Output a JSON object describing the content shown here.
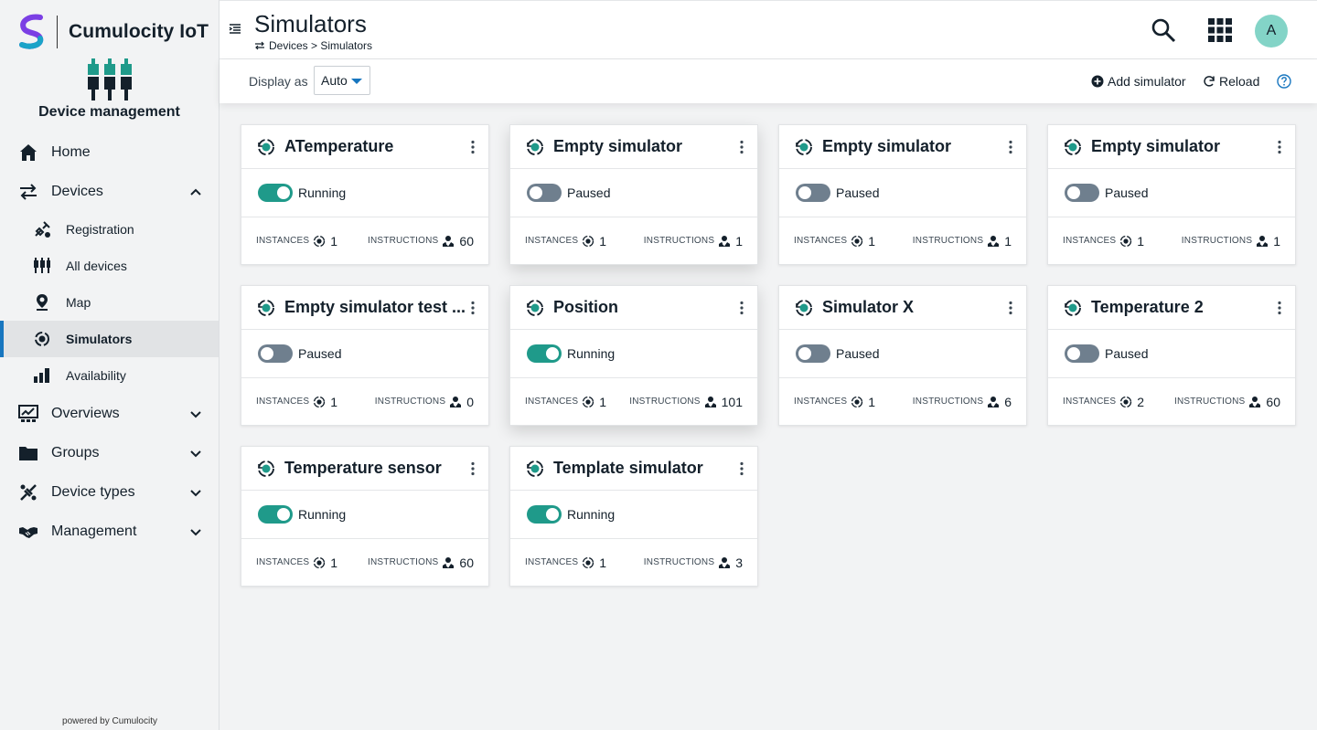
{
  "brand": {
    "name": "Cumulocity IoT",
    "logo_icon": "cumulocity-logo-icon"
  },
  "app": {
    "title": "Device management",
    "icon": "device-management-icon"
  },
  "sidebar": {
    "items": [
      {
        "label": "Home",
        "icon": "home-icon"
      },
      {
        "label": "Devices",
        "icon": "exchange-arrows-icon",
        "expanded": true,
        "children": [
          {
            "label": "Registration",
            "icon": "registration-icon"
          },
          {
            "label": "All devices",
            "icon": "all-devices-icon"
          },
          {
            "label": "Map",
            "icon": "map-pin-icon"
          },
          {
            "label": "Simulators",
            "icon": "simulator-icon",
            "active": true
          },
          {
            "label": "Availability",
            "icon": "availability-icon"
          }
        ]
      },
      {
        "label": "Overviews",
        "icon": "overviews-icon"
      },
      {
        "label": "Groups",
        "icon": "folder-icon"
      },
      {
        "label": "Device types",
        "icon": "device-types-icon"
      },
      {
        "label": "Management",
        "icon": "handshake-icon"
      }
    ],
    "powered_by": "powered by Cumulocity"
  },
  "header": {
    "title": "Simulators",
    "breadcrumb": "Devices > Simulators",
    "avatar_initial": "A"
  },
  "actionbar": {
    "display_label": "Display as",
    "display_value": "Auto",
    "add_label": "Add simulator",
    "reload_label": "Reload"
  },
  "labels": {
    "instances": "INSTANCES",
    "instructions": "INSTRUCTIONS"
  },
  "colors": {
    "accent": "#1776bf",
    "running": "#1f9a8a",
    "paused": "#6f7f8e",
    "avatar": "#83d4c7"
  },
  "simulators": [
    {
      "name": "ATemperature",
      "status": "Running",
      "running": true,
      "instances": "1",
      "instructions": "60"
    },
    {
      "name": "Empty simulator",
      "status": "Paused",
      "running": false,
      "instances": "1",
      "instructions": "1"
    },
    {
      "name": "Empty simulator",
      "status": "Paused",
      "running": false,
      "instances": "1",
      "instructions": "1"
    },
    {
      "name": "Empty simulator",
      "status": "Paused",
      "running": false,
      "instances": "1",
      "instructions": "1"
    },
    {
      "name": "Empty simulator test ...",
      "status": "Paused",
      "running": false,
      "instances": "1",
      "instructions": "0"
    },
    {
      "name": "Position",
      "status": "Running",
      "running": true,
      "instances": "1",
      "instructions": "101"
    },
    {
      "name": "Simulator X",
      "status": "Paused",
      "running": false,
      "instances": "1",
      "instructions": "6"
    },
    {
      "name": "Temperature 2",
      "status": "Paused",
      "running": false,
      "instances": "2",
      "instructions": "60"
    },
    {
      "name": "Temperature sensor",
      "status": "Running",
      "running": true,
      "instances": "1",
      "instructions": "60"
    },
    {
      "name": "Template simulator",
      "status": "Running",
      "running": true,
      "instances": "1",
      "instructions": "3"
    }
  ]
}
